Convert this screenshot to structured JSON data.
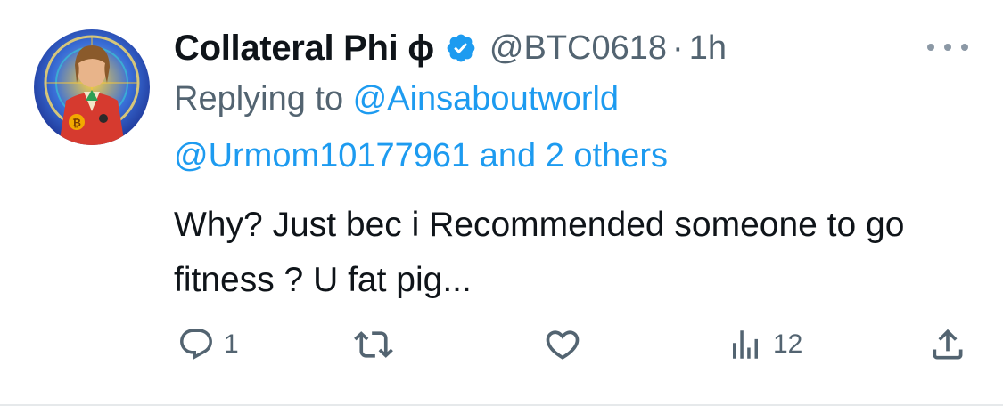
{
  "author": {
    "display_name": "Collateral Phi ϕ",
    "handle": "@BTC0618",
    "separator": "·",
    "time": "1h",
    "verified": true,
    "verified_color": "#1d9bf0"
  },
  "reply_context": {
    "prefix": "Replying to ",
    "mention_1": "@Ainsaboutworld",
    "mention_2": "@Urmom10177961",
    "others": " and 2 others"
  },
  "tweet": {
    "text": "Why? Just bec i Recommended someone to go fitness ? U fat pig..."
  },
  "actions": {
    "reply_count": "1",
    "retweet_count": "",
    "like_count": "",
    "views_count": "12"
  },
  "icons": {
    "more": "more-dots-icon",
    "reply": "reply-bubble-icon",
    "retweet": "retweet-icon",
    "like": "heart-icon",
    "views": "views-bar-icon",
    "share": "share-upload-icon"
  },
  "colors": {
    "text": "#0f1419",
    "secondary": "#536471",
    "link": "#1d9bf0"
  }
}
